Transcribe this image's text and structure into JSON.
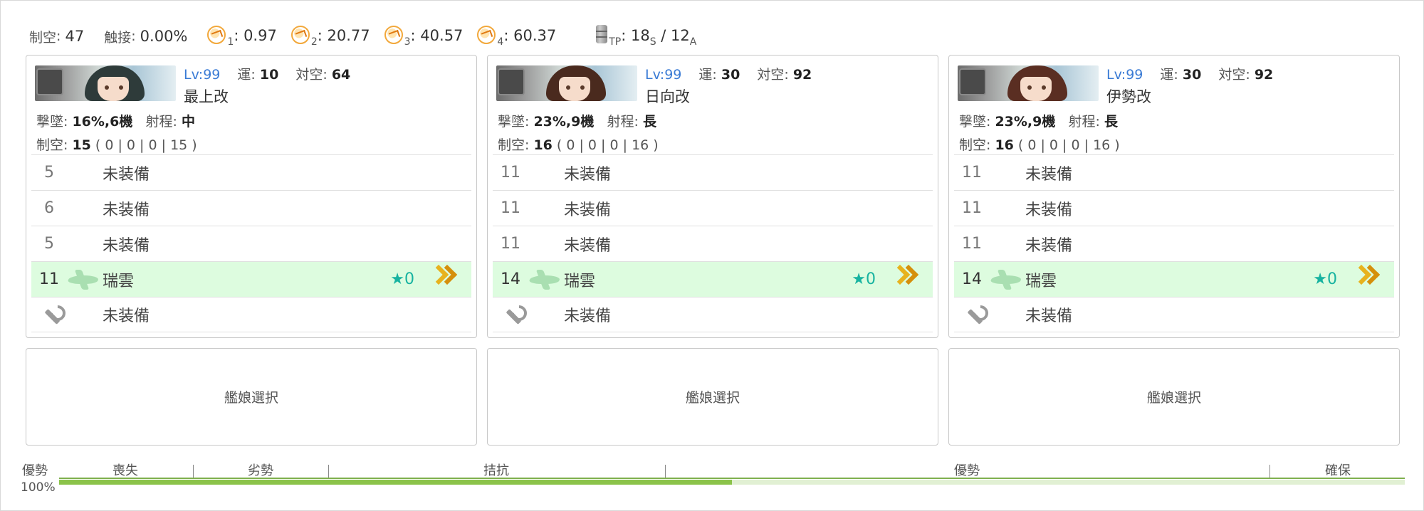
{
  "summary": {
    "air_label": "制空",
    "air_value": "47",
    "contact_label": "触接",
    "contact_value": "0.00%",
    "phases": [
      {
        "sub": "1",
        "value": ": 0.97"
      },
      {
        "sub": "2",
        "value": ": 20.77"
      },
      {
        "sub": "3",
        "value": ": 40.57"
      },
      {
        "sub": "4",
        "value": ": 60.37"
      }
    ],
    "tp_sub": "TP",
    "tp_s": ": 18",
    "tp_s_sub": "S",
    "tp_a": "/ 12",
    "tp_a_sub": "A"
  },
  "ships": [
    {
      "banner_icon": "ship-banner-portrait",
      "lv": "Lv:99",
      "luck_label": "運:",
      "luck": "10",
      "aa_label": "対空:",
      "aa": "64",
      "name": "最上改",
      "shootdown_label": "撃墜:",
      "shootdown": "16%,6機",
      "range_label": "射程:",
      "range": "中",
      "air_label": "制空:",
      "air": "15",
      "air_slots": "( 0 | 0 | 0 | 15 )",
      "slots": [
        {
          "count": "5",
          "name": "未装備",
          "equipped": false
        },
        {
          "count": "6",
          "name": "未装備",
          "equipped": false
        },
        {
          "count": "5",
          "name": "未装備",
          "equipped": false
        },
        {
          "count": "11",
          "name": "瑞雲",
          "equipped": true,
          "improve": "★0",
          "icon": "seaplane-bomber-icon",
          "proficiency": "max-proficiency-chevron"
        },
        {
          "count": "",
          "name": "未装備",
          "equipped": false,
          "reinforce": true
        }
      ]
    },
    {
      "banner_icon": "ship-banner-portrait",
      "lv": "Lv:99",
      "luck_label": "運:",
      "luck": "30",
      "aa_label": "対空:",
      "aa": "92",
      "name": "日向改",
      "shootdown_label": "撃墜:",
      "shootdown": "23%,9機",
      "range_label": "射程:",
      "range": "長",
      "air_label": "制空:",
      "air": "16",
      "air_slots": "( 0 | 0 | 0 | 16 )",
      "slots": [
        {
          "count": "11",
          "name": "未装備",
          "equipped": false
        },
        {
          "count": "11",
          "name": "未装備",
          "equipped": false
        },
        {
          "count": "11",
          "name": "未装備",
          "equipped": false
        },
        {
          "count": "14",
          "name": "瑞雲",
          "equipped": true,
          "improve": "★0",
          "icon": "seaplane-bomber-icon",
          "proficiency": "max-proficiency-chevron"
        },
        {
          "count": "",
          "name": "未装備",
          "equipped": false,
          "reinforce": true
        }
      ]
    },
    {
      "banner_icon": "ship-banner-portrait",
      "lv": "Lv:99",
      "luck_label": "運:",
      "luck": "30",
      "aa_label": "対空:",
      "aa": "92",
      "name": "伊勢改",
      "shootdown_label": "撃墜:",
      "shootdown": "23%,9機",
      "range_label": "射程:",
      "range": "長",
      "air_label": "制空:",
      "air": "16",
      "air_slots": "( 0 | 0 | 0 | 16 )",
      "slots": [
        {
          "count": "11",
          "name": "未装備",
          "equipped": false
        },
        {
          "count": "11",
          "name": "未装備",
          "equipped": false
        },
        {
          "count": "11",
          "name": "未装備",
          "equipped": false
        },
        {
          "count": "14",
          "name": "瑞雲",
          "equipped": true,
          "improve": "★0",
          "icon": "seaplane-bomber-icon",
          "proficiency": "max-proficiency-chevron"
        },
        {
          "count": "",
          "name": "未装備",
          "equipped": false,
          "reinforce": true
        }
      ]
    }
  ],
  "select_label": "艦娘選択",
  "air_bar": {
    "state_label": "優勢",
    "percent": "100%",
    "fill_fraction": 0.5,
    "zones": [
      "喪失",
      "劣勢",
      "拮抗",
      "優勢",
      "確保"
    ]
  },
  "colors": {
    "lv_blue": "#3a7bd5",
    "equipped_bg": "#ddfcdf",
    "star_teal": "#17b3a0",
    "proficiency_gold": "#e2a314",
    "bar_green": "#8bc34a"
  }
}
